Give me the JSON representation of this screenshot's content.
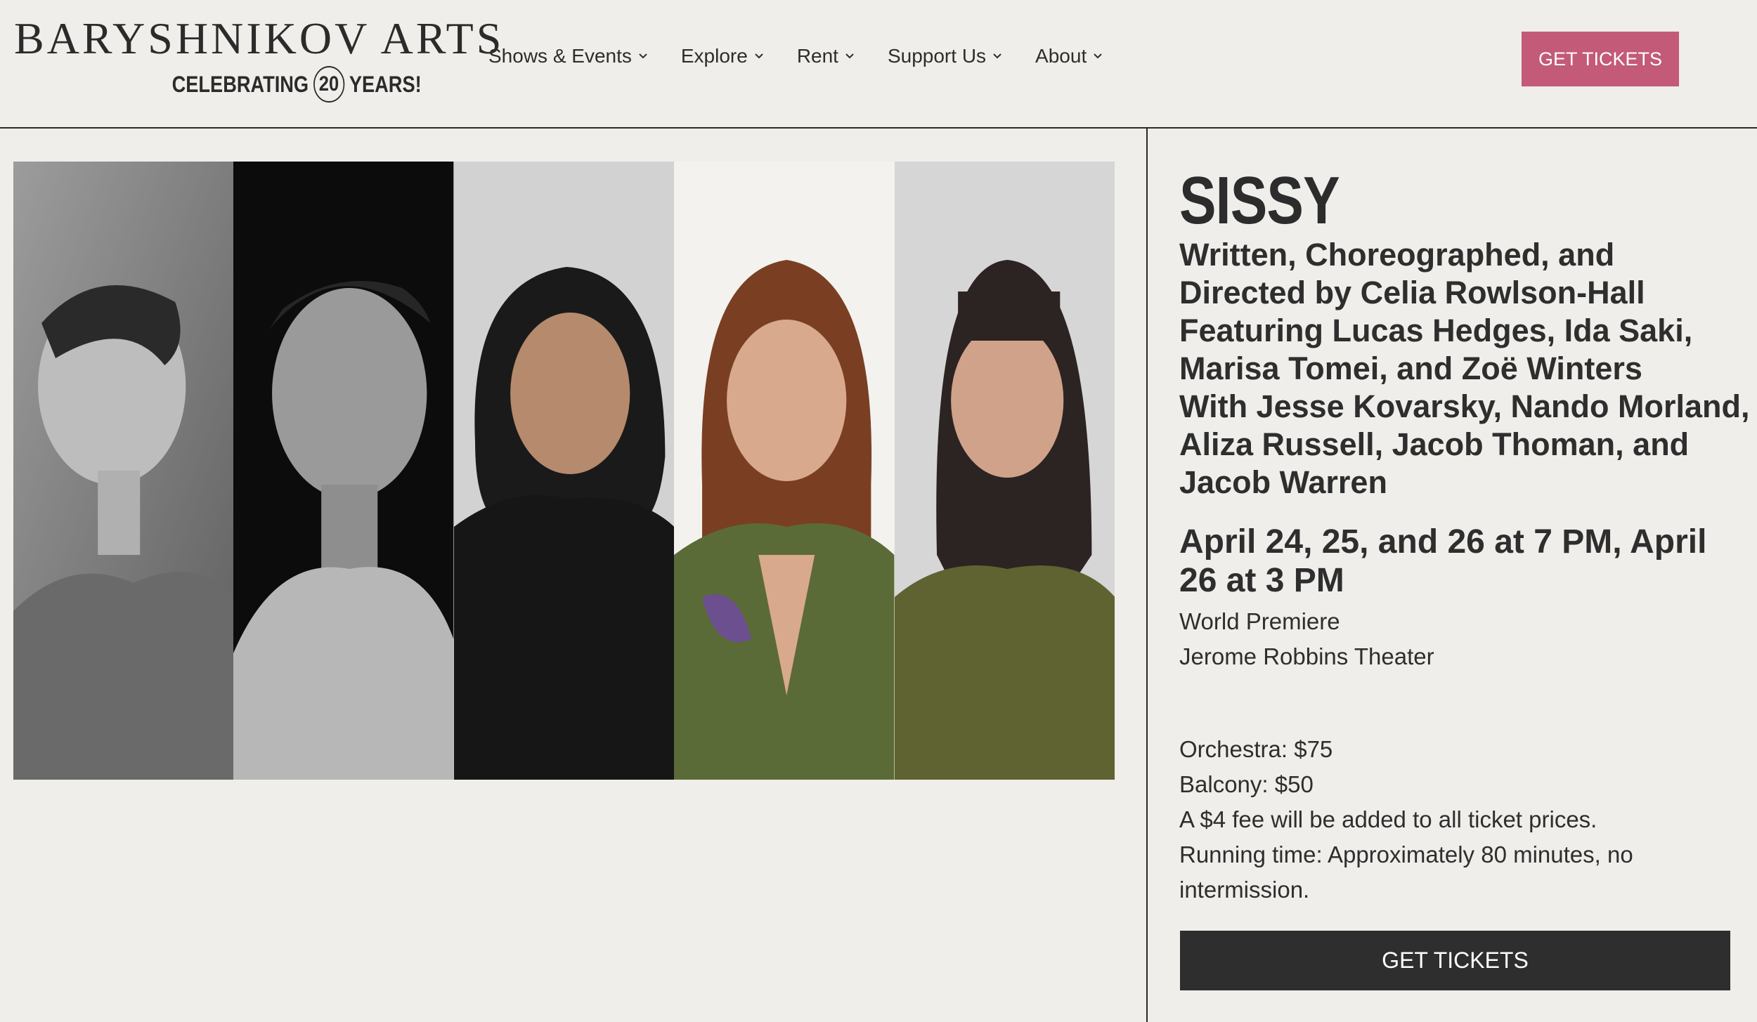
{
  "header": {
    "logo_title": "BARYSHNIKOV ARTS",
    "logo_sub_before": "CELEBRATING",
    "logo_sub_number": "20",
    "logo_sub_after": "YEARS!",
    "nav": [
      {
        "label": "Shows & Events"
      },
      {
        "label": "Explore"
      },
      {
        "label": "Rent"
      },
      {
        "label": "Support Us"
      },
      {
        "label": "About"
      }
    ],
    "cta_label": "GET TICKETS",
    "cta_color": "#c35a78"
  },
  "event": {
    "title": "SISSY",
    "credits": [
      "Written, Choreographed, and",
      "Directed by Celia Rowlson-Hall",
      "Featuring Lucas Hedges, Ida Saki,",
      "Marisa Tomei, and Zoë Winters",
      "With Jesse Kovarsky, Nando Morland,",
      "Aliza Russell, Jacob Thoman, and",
      "Jacob Warren"
    ],
    "dates": "April 24, 25, and 26 at 7 PM, April 26 at 3 PM",
    "premiere": "World Premiere",
    "venue": "Jerome Robbins Theater",
    "pricing": [
      "Orchestra: $75",
      "Balcony: $50",
      "A $4 fee will be added to all ticket prices.",
      "Running time: Approximately 80 minutes, no intermission."
    ],
    "cta_label": "GET TICKETS",
    "cta_color": "#2e2e2e"
  }
}
